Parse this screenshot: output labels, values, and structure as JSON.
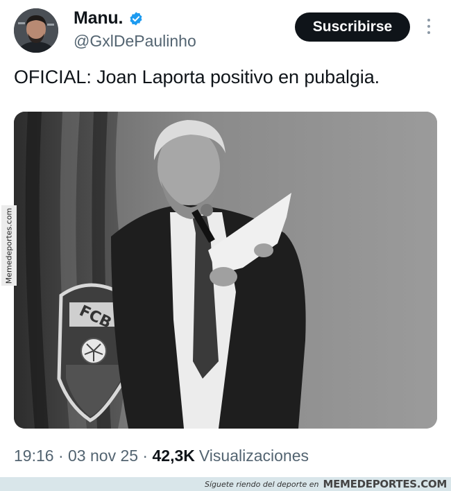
{
  "tweet": {
    "author_name": "Manu.",
    "handle": "@GxlDePaulinho",
    "subscribe_label": "Suscribirse",
    "text": "OFICIAL: Joan Laporta positivo en pubalgia.",
    "time": "19:16",
    "date": "03 nov 25",
    "views_count": "42,3K",
    "views_label": "Visualizaciones",
    "separator": " · "
  },
  "watermark": {
    "side_text": "Memedeportes.com",
    "footer_tagline": "Síguete riendo del deporte en",
    "footer_brand": "MEMEDEPORTES.COM"
  },
  "colors": {
    "accent": "#1d9bf0",
    "button_bg": "#0f1419",
    "secondary_text": "#536471",
    "footer_bg": "#d9e6ea"
  }
}
